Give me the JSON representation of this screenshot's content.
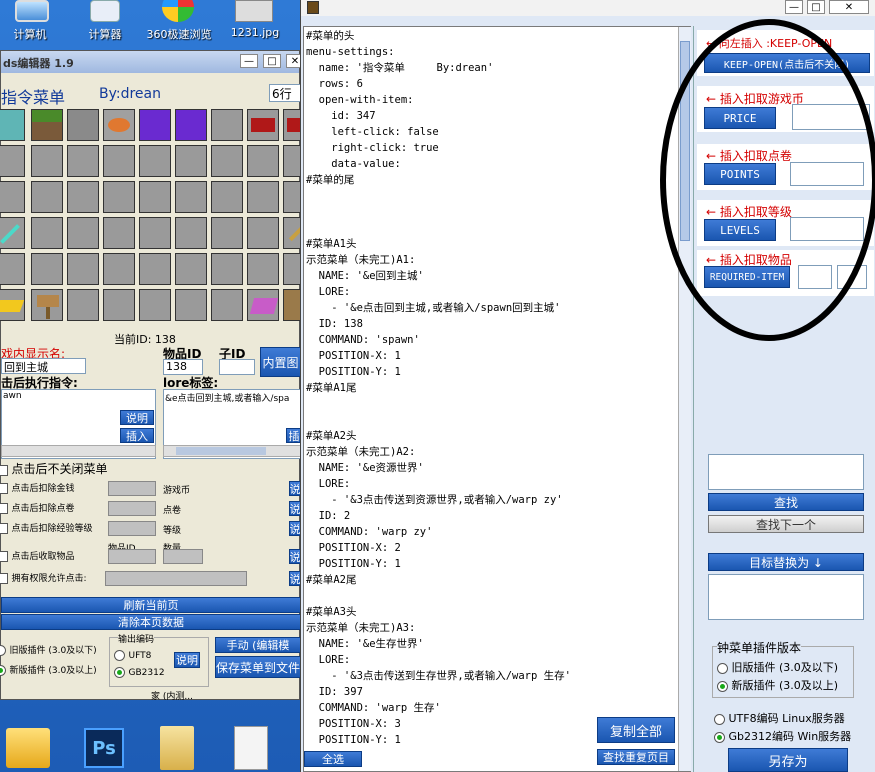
{
  "desktop": {
    "icons": [
      {
        "label": "计算机",
        "icon": "computer-icon"
      },
      {
        "label": "计算器",
        "icon": "calculator-icon"
      },
      {
        "label": "360极速浏览",
        "icon": "browser-icon"
      },
      {
        "label": "1231.jpg",
        "icon": "image-file-icon"
      }
    ],
    "taskbar_icons": [
      "folder-icon",
      "photoshop-icon",
      "files-icon",
      "document-icon"
    ]
  },
  "left_window": {
    "title": "ds编辑器 1.9",
    "menu_name": "指令菜单",
    "author": "By:drean",
    "rows_select": "6行",
    "current_id_label": "当前ID: 138",
    "display_name_label": "戏内显示名:",
    "display_name_value": "回到主城",
    "item_id_label": "物品ID",
    "sub_id_label": "子ID",
    "item_id_value": "138",
    "sub_id_value": "",
    "inner_button": "内置图",
    "command_label": "击后执行指令:",
    "command_value": "awn",
    "lore_label": "lore标签:",
    "lore_value": "&e点击回到主城,或者输入/spa",
    "explain_btn": "说明",
    "insert_btn": "插入",
    "insert_btn2": "插",
    "keep_open_check": "点击后不关闭菜单",
    "options": [
      {
        "label": "点击后扣除金钱",
        "unit": "游戏币"
      },
      {
        "label": "点击后扣除点卷",
        "unit": "点卷"
      },
      {
        "label": "点击后扣除经验等级",
        "unit": "等级"
      },
      {
        "label": "点击后收取物品",
        "unit": ""
      },
      {
        "label": "拥有权限允许点击:",
        "unit": ""
      }
    ],
    "item_id_small": "物品ID",
    "quantity_small": "数量",
    "explain_short": "说",
    "refresh_btn": "刷新当前页",
    "clear_btn": "清除本页数据",
    "old_version": "旧版插件 (3.0及以下)",
    "new_version": "新版插件 (3.0及以上)",
    "output_encoding": "输出编码",
    "enc_utf8": "UFT8",
    "enc_gb": "GB2312",
    "explain_btn2": "说明",
    "manual_btn": "手动 (编辑模",
    "save_btn": "保存菜单到文件",
    "status": "家 (内测..."
  },
  "editor": {
    "lines": [
      "#菜单的头",
      "menu-settings:",
      "  name: '指令菜单     By:drean'",
      "  rows: 6",
      "  open-with-item:",
      "    id: 347",
      "    left-click: false",
      "    right-click: true",
      "    data-value:",
      "#菜单的尾",
      "",
      "",
      "",
      "#菜单A1头",
      "示范菜单（未完工)A1:",
      "  NAME: '&e回到主城'",
      "  LORE:",
      "    - '&e点击回到主城,或者输入/spawn回到主城'",
      "  ID: 138",
      "  COMMAND: 'spawn'",
      "  POSITION-X: 1",
      "  POSITION-Y: 1",
      "#菜单A1尾",
      "",
      "",
      "#菜单A2头",
      "示范菜单（未完工)A2:",
      "  NAME: '&e资源世界'",
      "  LORE:",
      "    - '&3点击传送到资源世界,或者输入/warp zy'",
      "  ID: 2",
      "  COMMAND: 'warp zy'",
      "  POSITION-X: 2",
      "  POSITION-Y: 1",
      "#菜单A2尾",
      "",
      "#菜单A3头",
      "示范菜单（未完工)A3:",
      "  NAME: '&e生存世界'",
      "  LORE:",
      "    - '&3点击传送到生存世界,或者输入/warp 生存'",
      "  ID: 397",
      "  COMMAND: 'warp 生存'",
      "  POSITION-X: 3",
      "  POSITION-Y: 1"
    ],
    "select_all": "全选",
    "copy_all": "复制全部",
    "find_dup": "查找重复页目"
  },
  "right_panel": {
    "hint_keep_open": "← 向左插入 :KEEP-OPEN",
    "keep_open_btn": "KEEP-OPEN(点击后不关闭)",
    "hint_price": "← 插入扣取游戏币",
    "price_btn": "PRICE",
    "hint_points": "← 插入扣取点卷",
    "points_btn": "POINTS",
    "hint_levels": "← 插入扣取等级",
    "levels_btn": "LEVELS",
    "hint_item": "← 插入扣取物品",
    "item_btn": "REQUIRED-ITEM",
    "find_btn": "查找",
    "find_next_btn": "查找下一个",
    "replace_btn": "目标替换为 ↓",
    "version_title": "钟菜单插件版本",
    "old_version": "旧版插件 (3.0及以下)",
    "new_version": "新版插件 (3.0及以上)",
    "enc_utf8": "UTF8编码 Linux服务器",
    "enc_gb": "Gb2312编码  Win服务器",
    "save_as": "另存为",
    "colors": {
      "accent": "#1a56b0",
      "hint_red": "#d40000",
      "highlight_circle": "#000000"
    }
  },
  "window_controls": {
    "minimize": "—",
    "maximize": "□",
    "close": "✕"
  }
}
